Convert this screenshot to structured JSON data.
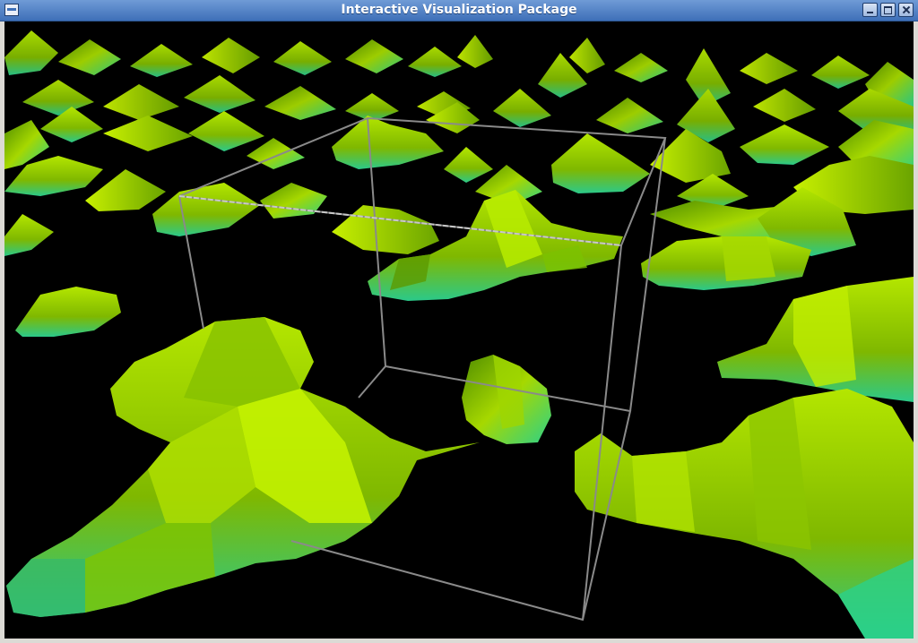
{
  "window": {
    "title": "Interactive Visualization Package",
    "controls": [
      "window-menu-icon",
      "minimize-icon",
      "maximize-icon",
      "close-icon"
    ]
  },
  "scene": {
    "background": "#000000",
    "surface_colors": [
      "#7fb800",
      "#a6d800",
      "#c8f000",
      "#4f8c00",
      "#2e6300",
      "#2bd18a"
    ],
    "bounding_box_color": "#8a8a8a"
  }
}
